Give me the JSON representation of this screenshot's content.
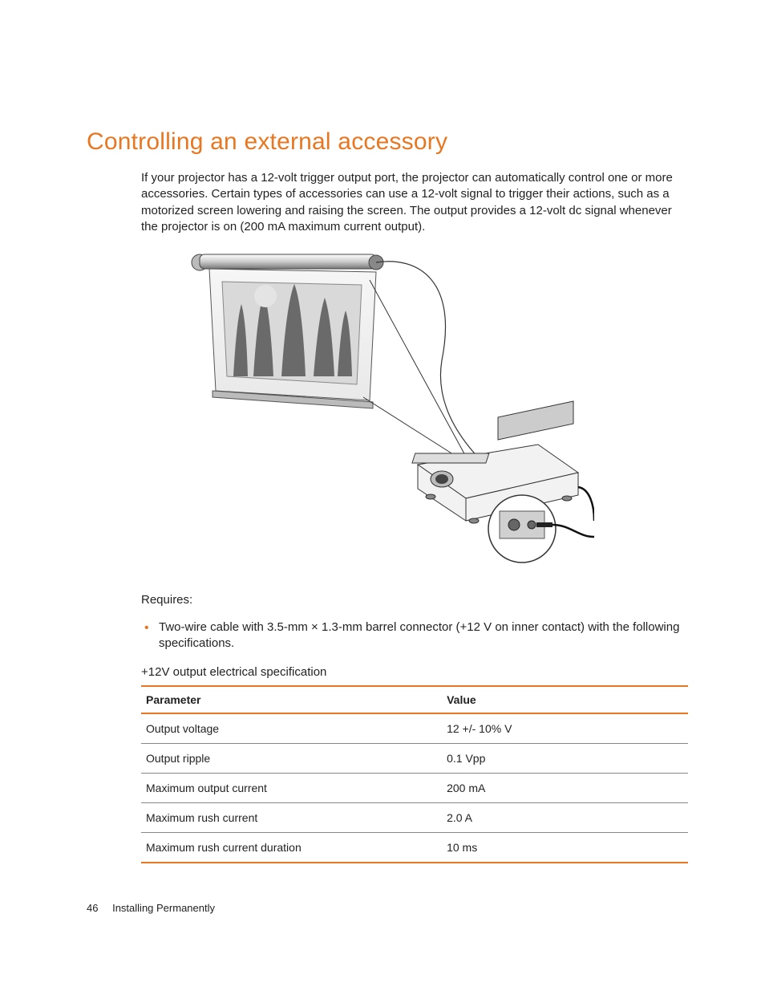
{
  "heading": "Controlling an external accessory",
  "intro": "If your projector has a 12-volt trigger output port, the projector can automatically control one or more accessories. Certain types of accessories can use a 12-volt signal to trigger their actions, such as a motorized screen lowering and raising the screen. The output provides a 12-volt dc signal whenever the projector is on (200 mA maximum current output).",
  "requires_label": "Requires:",
  "bullets": [
    "Two-wire cable with 3.5-mm × 1.3-mm barrel connector (+12 V on inner contact) with the following specifications."
  ],
  "table_caption": "+12V output electrical specification",
  "table": {
    "headers": {
      "param": "Parameter",
      "value": "Value"
    },
    "rows": [
      {
        "param": "Output voltage",
        "value": "12 +/- 10% V"
      },
      {
        "param": "Output ripple",
        "value": "0.1 Vpp"
      },
      {
        "param": "Maximum output current",
        "value": "200 mA"
      },
      {
        "param": "Maximum rush current",
        "value": "2.0 A"
      },
      {
        "param": "Maximum rush current duration",
        "value": "10 ms"
      }
    ]
  },
  "footer": {
    "page": "46",
    "section": "Installing Permanently"
  }
}
